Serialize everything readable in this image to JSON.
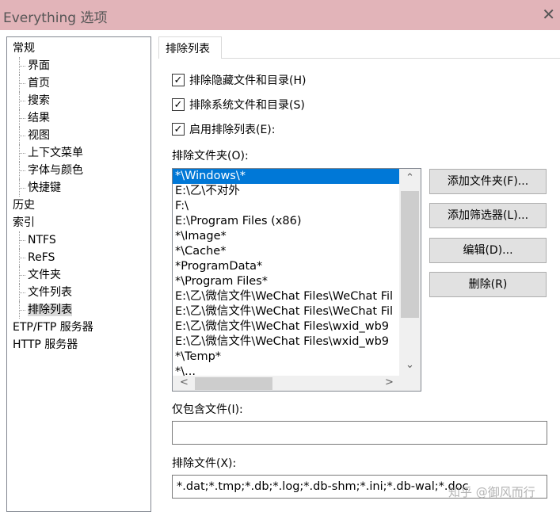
{
  "window": {
    "title": "Everything 选项",
    "close_icon": "close-icon"
  },
  "tree": [
    {
      "label": "常规",
      "level": 0
    },
    {
      "label": "界面",
      "level": 1
    },
    {
      "label": "首页",
      "level": 1
    },
    {
      "label": "搜索",
      "level": 1
    },
    {
      "label": "结果",
      "level": 1
    },
    {
      "label": "视图",
      "level": 1
    },
    {
      "label": "上下文菜单",
      "level": 1
    },
    {
      "label": "字体与颜色",
      "level": 1
    },
    {
      "label": "快捷键",
      "level": 1
    },
    {
      "label": "历史",
      "level": 0
    },
    {
      "label": "索引",
      "level": 0
    },
    {
      "label": "NTFS",
      "level": 1
    },
    {
      "label": "ReFS",
      "level": 1
    },
    {
      "label": "文件夹",
      "level": 1
    },
    {
      "label": "文件列表",
      "level": 1
    },
    {
      "label": "排除列表",
      "level": 1,
      "selected": true
    },
    {
      "label": "ETP/FTP 服务器",
      "level": 0
    },
    {
      "label": "HTTP 服务器",
      "level": 0
    }
  ],
  "tab": "排除列表",
  "checkboxes": [
    {
      "label": "排除隐藏文件和目录(H)",
      "checked": true
    },
    {
      "label": "排除系统文件和目录(S)",
      "checked": true
    },
    {
      "label": "启用排除列表(E):",
      "checked": true
    }
  ],
  "folders_label": "排除文件夹(O):",
  "folders": [
    "*\\Windows\\*",
    "E:\\乙\\不对外",
    "F:\\",
    "E:\\Program Files (x86)",
    "*\\Image*",
    "*\\Cache*",
    "*ProgramData*",
    "*\\Program Files*",
    "E:\\乙\\微信文件\\WeChat Files\\WeChat Fil",
    "E:\\乙\\微信文件\\WeChat Files\\WeChat Fil",
    "E:\\乙\\微信文件\\WeChat Files\\wxid_wb9",
    "E:\\乙\\微信文件\\WeChat Files\\wxid_wb9",
    "*\\Temp*",
    "*\\..."
  ],
  "buttons": {
    "add_folder": "添加文件夹(F)...",
    "add_filter": "添加筛选器(L)...",
    "edit": "编辑(D)...",
    "delete": "删除(R)"
  },
  "include_label": "仅包含文件(I):",
  "include_value": "",
  "exclude_files_label": "排除文件(X):",
  "exclude_files_value": "*.dat;*.tmp;*.db;*.log;*.db-shm;*.ini;*.db-wal;*.doc",
  "watermark": "知乎 @御风而行"
}
